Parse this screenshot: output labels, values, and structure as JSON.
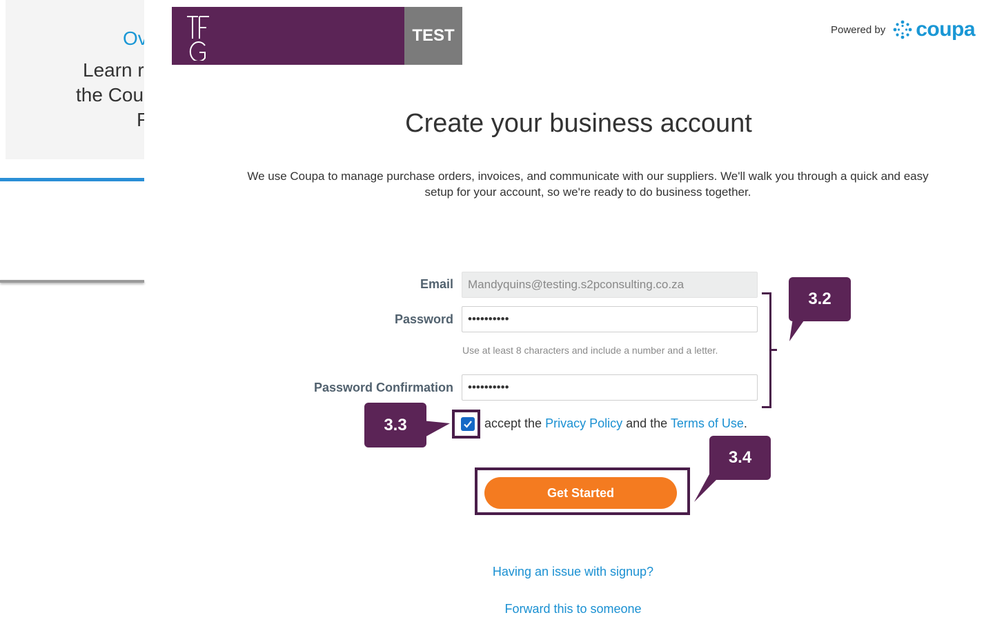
{
  "background": {
    "fragment_lines": [
      "Ov",
      "Learn r",
      "the Cou",
      "F"
    ]
  },
  "header": {
    "logo_mark_text": "TFG",
    "env_badge": "TEST",
    "powered_by": "Powered by",
    "brand": "coupa"
  },
  "main": {
    "title": "Create your business account",
    "description": "We use Coupa to manage purchase orders, invoices, and communicate with our suppliers. We'll walk you through a quick and easy setup for your account, so we're ready to do business together."
  },
  "form": {
    "email_label": "Email",
    "email_value": "Mandyquins@testing.s2pconsulting.co.za",
    "password_label": "Password",
    "password_value": "••••••••••",
    "password_hint": "Use at least 8 characters and include a number and a letter.",
    "confirm_label": "Password Confirmation",
    "confirm_value": "••••••••••",
    "accept_prefix": "accept the",
    "privacy_link": "Privacy Policy",
    "and_the": "and the",
    "terms_link": "Terms of Use",
    "period": ".",
    "checkbox_checked": true,
    "submit_label": "Get Started"
  },
  "callouts": {
    "step_32": "3.2",
    "step_33": "3.3",
    "step_34": "3.4"
  },
  "links": {
    "issue": "Having an issue with signup?",
    "forward": "Forward this to someone"
  },
  "colors": {
    "brand_purple": "#5b2456",
    "callout_purple": "#4a1e4a",
    "button_orange": "#f47b20",
    "link_blue": "#1a90d2",
    "coupa_blue": "#1a97d5"
  }
}
